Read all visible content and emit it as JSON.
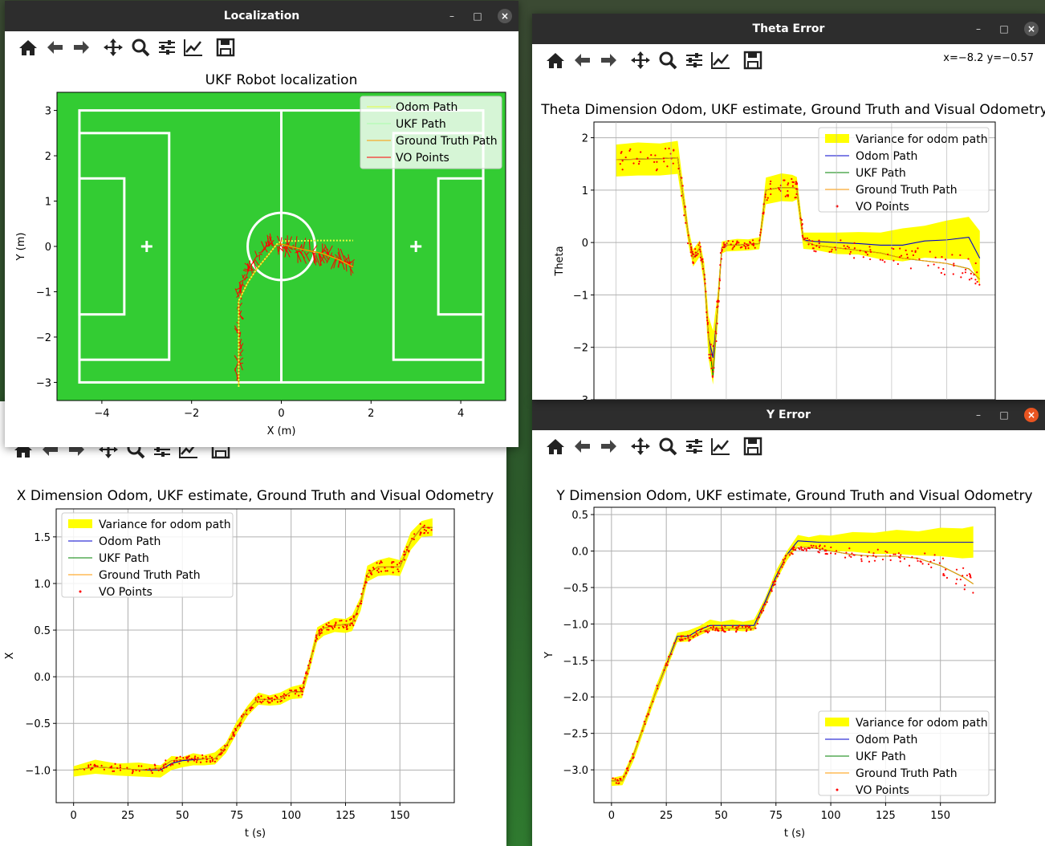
{
  "windows": {
    "localization": {
      "title": "Localization",
      "plot_title": "UKF Robot localization",
      "xlabel": "X (m)",
      "ylabel": "Y (m)",
      "xticks": [
        "−4",
        "−2",
        "0",
        "2",
        "4"
      ],
      "yticks": [
        "3",
        "2",
        "1",
        "0",
        "−1",
        "−2",
        "−3"
      ],
      "legend": [
        "Odom Path",
        "UKF Path",
        "Ground Truth Path",
        "VO Points"
      ]
    },
    "theta": {
      "title": "Theta Error",
      "coords": "x=−8.2 y=−0.57",
      "plot_title": "Theta Dimension Odom, UKF estimate, Ground Truth and Visual Odometry",
      "ylabel": "Theta",
      "yticks": [
        "2",
        "1",
        "0",
        "−1",
        "−2",
        "−3"
      ],
      "legend": [
        "Variance for odom path",
        "Odom Path",
        "UKF Path",
        "Ground Truth Path",
        "VO Points"
      ]
    },
    "xerror": {
      "plot_title": "X Dimension Odom, UKF estimate, Ground Truth and Visual Odometry",
      "xlabel": "t (s)",
      "ylabel": "X",
      "xticks": [
        "0",
        "25",
        "50",
        "75",
        "100",
        "125",
        "150"
      ],
      "yticks": [
        "1.5",
        "1.0",
        "0.5",
        "0.0",
        "−0.5",
        "−1.0"
      ],
      "legend": [
        "Variance for odom path",
        "Odom Path",
        "UKF Path",
        "Ground Truth Path",
        "VO Points"
      ]
    },
    "yerror": {
      "title": "Y Error",
      "plot_title": "Y Dimension Odom, UKF estimate, Ground Truth and Visual Odometry",
      "xlabel": "t (s)",
      "ylabel": "Y",
      "xticks": [
        "0",
        "25",
        "50",
        "75",
        "100",
        "125",
        "150"
      ],
      "yticks": [
        "0.5",
        "0.0",
        "−0.5",
        "−1.0",
        "−1.5",
        "−2.0",
        "−2.5",
        "−3.0"
      ],
      "legend": [
        "Variance for odom path",
        "Odom Path",
        "UKF Path",
        "Ground Truth Path",
        "VO Points"
      ]
    }
  },
  "window_controls": {
    "minimize": "–",
    "maximize": "□",
    "close": "×"
  },
  "toolbar_icons": [
    "home-icon",
    "back-arrow-icon",
    "forward-arrow-icon",
    "pan-icon",
    "zoom-icon",
    "configure-subplots-icon",
    "edit-axis-icon",
    "save-icon"
  ],
  "colors": {
    "odom": "#0000cc",
    "ukf": "#008000",
    "ground_truth": "#ff9900",
    "vo": "#ff0000",
    "variance": "#ffff00",
    "field": "#33cc33"
  },
  "chart_data": [
    {
      "type": "line",
      "title": "UKF Robot localization",
      "xlabel": "X (m)",
      "ylabel": "Y (m)",
      "xlim": [
        -5.0,
        5.0
      ],
      "ylim": [
        -3.4,
        3.4
      ],
      "series": [
        {
          "name": "Odom Path",
          "x": [
            -0.95,
            -0.95,
            -0.95,
            -0.75,
            -0.55,
            -0.3,
            -0.1,
            0.0,
            0.3,
            0.8,
            1.3,
            1.6
          ],
          "y": [
            -3.1,
            -2.0,
            -1.2,
            -0.8,
            -0.5,
            -0.2,
            0.05,
            0.12,
            0.12,
            0.13,
            0.13,
            0.13
          ]
        },
        {
          "name": "UKF Path",
          "x": [
            -0.95,
            -0.95,
            -0.95,
            -0.75,
            -0.55,
            -0.3,
            -0.1,
            0.0,
            0.4,
            0.9,
            1.3,
            1.6
          ],
          "y": [
            -3.1,
            -2.0,
            -1.2,
            -0.8,
            -0.5,
            -0.2,
            0.05,
            0.05,
            -0.05,
            -0.15,
            -0.3,
            -0.45
          ]
        },
        {
          "name": "Ground Truth Path",
          "x": [
            -0.95,
            -0.95,
            -0.95,
            -0.75,
            -0.55,
            -0.3,
            -0.1,
            0.0,
            0.4,
            0.9,
            1.3,
            1.6
          ],
          "y": [
            -3.1,
            -2.0,
            -1.2,
            -0.8,
            -0.5,
            -0.2,
            0.05,
            0.05,
            -0.05,
            -0.15,
            -0.3,
            -0.45
          ]
        },
        {
          "name": "VO Points",
          "x": [
            -0.95,
            -0.95,
            -0.95,
            -0.8,
            -0.6,
            -0.3,
            0.1,
            0.4,
            0.8,
            1.1,
            1.4,
            1.6
          ],
          "y": [
            -3.0,
            -2.0,
            -1.1,
            -0.6,
            -0.3,
            0.0,
            0.0,
            -0.1,
            -0.15,
            -0.2,
            -0.3,
            -0.45
          ]
        }
      ]
    },
    {
      "type": "line",
      "title": "Theta Dimension Odom, UKF estimate, Ground Truth and Visual Odometry",
      "ylabel": "Theta",
      "xlim": [
        -10,
        172
      ],
      "ylim": [
        -3.0,
        2.3
      ],
      "x": [
        0,
        10,
        20,
        28,
        33,
        35,
        38,
        40,
        42,
        44,
        46,
        48,
        50,
        55,
        60,
        65,
        68,
        75,
        80,
        82,
        85,
        90,
        100,
        110,
        120,
        130,
        140,
        150,
        160,
        165
      ],
      "series": [
        {
          "name": "Odom Path",
          "values": [
            1.58,
            1.59,
            1.6,
            1.62,
            0.1,
            -0.3,
            -0.1,
            -0.6,
            -1.8,
            -2.2,
            -1.3,
            -0.1,
            -0.05,
            -0.05,
            -0.03,
            -0.02,
            1.0,
            1.05,
            1.05,
            1.03,
            0.05,
            0.02,
            0.0,
            -0.02,
            -0.05,
            -0.05,
            0.03,
            0.05,
            0.1,
            -0.3
          ]
        },
        {
          "name": "UKF Path",
          "values": [
            1.58,
            1.59,
            1.6,
            1.62,
            0.1,
            -0.3,
            -0.1,
            -0.6,
            -1.8,
            -2.55,
            -1.3,
            -0.1,
            -0.05,
            -0.05,
            -0.03,
            -0.02,
            1.0,
            1.05,
            1.05,
            1.03,
            0.05,
            -0.05,
            -0.1,
            -0.15,
            -0.2,
            -0.3,
            -0.35,
            -0.4,
            -0.5,
            -0.7
          ]
        },
        {
          "name": "Ground Truth Path",
          "values": [
            1.58,
            1.59,
            1.6,
            1.62,
            0.1,
            -0.3,
            -0.1,
            -0.6,
            -1.8,
            -2.4,
            -1.3,
            -0.1,
            -0.05,
            -0.05,
            -0.03,
            -0.02,
            1.0,
            1.05,
            1.05,
            1.03,
            0.05,
            -0.05,
            -0.1,
            -0.15,
            -0.2,
            -0.3,
            -0.35,
            -0.4,
            -0.5,
            -0.7
          ]
        }
      ],
      "variance_half_width": [
        0.3,
        0.3,
        0.3,
        0.3,
        0.15,
        0.15,
        0.15,
        0.2,
        0.4,
        0.5,
        0.3,
        0.1,
        0.1,
        0.1,
        0.1,
        0.1,
        0.25,
        0.25,
        0.25,
        0.2,
        0.15,
        0.15,
        0.2,
        0.2,
        0.25,
        0.3,
        0.3,
        0.35,
        0.4,
        0.5
      ]
    },
    {
      "type": "line",
      "title": "X Dimension Odom, UKF estimate, Ground Truth and Visual Odometry",
      "xlabel": "t (s)",
      "ylabel": "X",
      "xlim": [
        -8,
        175
      ],
      "ylim": [
        -1.35,
        1.8
      ],
      "x": [
        0,
        10,
        20,
        30,
        40,
        45,
        50,
        55,
        60,
        65,
        70,
        75,
        80,
        85,
        90,
        95,
        100,
        105,
        108,
        112,
        115,
        120,
        125,
        128,
        132,
        135,
        140,
        145,
        150,
        155,
        160,
        165
      ],
      "series": [
        {
          "name": "Odom Path",
          "values": [
            -1.0,
            -0.97,
            -0.98,
            -1.0,
            -1.0,
            -0.93,
            -0.9,
            -0.89,
            -0.88,
            -0.88,
            -0.75,
            -0.55,
            -0.35,
            -0.24,
            -0.24,
            -0.24,
            -0.16,
            -0.16,
            0.1,
            0.45,
            0.52,
            0.55,
            0.56,
            0.57,
            0.8,
            1.1,
            1.18,
            1.18,
            1.18,
            1.45,
            1.6,
            1.6
          ]
        },
        {
          "name": "UKF Path",
          "values": [
            -1.0,
            -0.97,
            -0.98,
            -1.0,
            -0.98,
            -0.9,
            -0.89,
            -0.88,
            -0.88,
            -0.88,
            -0.75,
            -0.55,
            -0.35,
            -0.24,
            -0.24,
            -0.24,
            -0.16,
            -0.16,
            0.1,
            0.45,
            0.52,
            0.55,
            0.56,
            0.57,
            0.8,
            1.1,
            1.18,
            1.18,
            1.18,
            1.45,
            1.6,
            1.6
          ]
        },
        {
          "name": "Ground Truth Path",
          "values": [
            -1.0,
            -0.97,
            -0.98,
            -1.0,
            -0.98,
            -0.9,
            -0.89,
            -0.88,
            -0.88,
            -0.88,
            -0.75,
            -0.55,
            -0.35,
            -0.24,
            -0.24,
            -0.24,
            -0.16,
            -0.16,
            0.1,
            0.45,
            0.52,
            0.55,
            0.56,
            0.57,
            0.8,
            1.1,
            1.18,
            1.18,
            1.18,
            1.45,
            1.6,
            1.6
          ]
        }
      ],
      "variance_half_width": [
        0.05,
        0.06,
        0.06,
        0.06,
        0.06,
        0.06,
        0.05,
        0.05,
        0.05,
        0.05,
        0.05,
        0.05,
        0.05,
        0.05,
        0.05,
        0.05,
        0.06,
        0.06,
        0.06,
        0.06,
        0.06,
        0.06,
        0.07,
        0.07,
        0.07,
        0.07,
        0.08,
        0.08,
        0.08,
        0.08,
        0.08,
        0.08
      ]
    },
    {
      "type": "line",
      "title": "Y Dimension Odom, UKF estimate, Ground Truth and Visual Odometry",
      "xlabel": "t (s)",
      "ylabel": "Y",
      "xlim": [
        -8,
        175
      ],
      "ylim": [
        -3.45,
        0.6
      ],
      "x": [
        0,
        5,
        10,
        20,
        30,
        35,
        40,
        45,
        50,
        55,
        60,
        65,
        70,
        75,
        80,
        85,
        90,
        95,
        100,
        110,
        120,
        130,
        140,
        150,
        160,
        165
      ],
      "series": [
        {
          "name": "Odom Path",
          "values": [
            -3.15,
            -3.15,
            -2.8,
            -1.95,
            -1.17,
            -1.17,
            -1.08,
            -1.02,
            -1.02,
            -1.02,
            -1.02,
            -1.02,
            -0.7,
            -0.35,
            -0.05,
            0.14,
            0.13,
            0.12,
            0.12,
            0.12,
            0.12,
            0.12,
            0.12,
            0.12,
            0.12,
            0.12
          ]
        },
        {
          "name": "UKF Path",
          "values": [
            -3.15,
            -3.15,
            -2.8,
            -1.95,
            -1.2,
            -1.2,
            -1.12,
            -1.06,
            -1.06,
            -1.06,
            -1.06,
            -1.06,
            -0.74,
            -0.38,
            -0.05,
            0.05,
            0.05,
            0.03,
            0.0,
            -0.05,
            -0.07,
            -0.07,
            -0.1,
            -0.2,
            -0.35,
            -0.45
          ]
        },
        {
          "name": "Ground Truth Path",
          "values": [
            -3.15,
            -3.15,
            -2.8,
            -1.95,
            -1.2,
            -1.2,
            -1.12,
            -1.06,
            -1.06,
            -1.06,
            -1.06,
            -1.06,
            -0.74,
            -0.38,
            -0.05,
            0.05,
            0.05,
            0.03,
            0.0,
            -0.05,
            -0.07,
            -0.07,
            -0.1,
            -0.2,
            -0.35,
            -0.45
          ]
        }
      ],
      "variance_half_width": [
        0.05,
        0.05,
        0.06,
        0.06,
        0.06,
        0.06,
        0.06,
        0.06,
        0.06,
        0.06,
        0.06,
        0.06,
        0.06,
        0.06,
        0.06,
        0.06,
        0.07,
        0.08,
        0.1,
        0.12,
        0.14,
        0.15,
        0.16,
        0.18,
        0.2,
        0.2
      ]
    }
  ]
}
